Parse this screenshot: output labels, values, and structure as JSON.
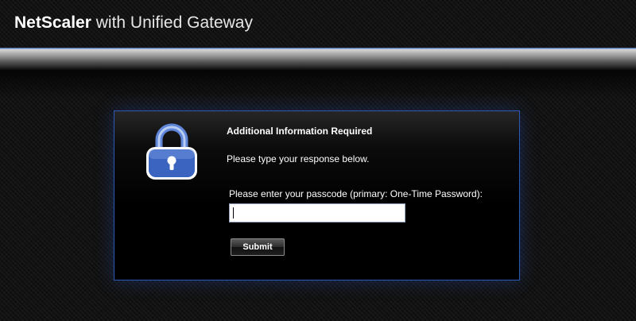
{
  "header": {
    "brand_bold": "NetScaler",
    "brand_rest": "with Unified Gateway"
  },
  "panel": {
    "icon": "lock-icon",
    "title": "Additional Information Required",
    "subtitle": "Please type your response below.",
    "prompt_label": "Please enter your passcode (primary: One-Time Password):",
    "passcode_value": "",
    "submit_label": "Submit"
  },
  "colors": {
    "accent": "#2f57b5",
    "lock_blue": "#3a64c0",
    "background": "#111111",
    "text": "#ffffff"
  }
}
